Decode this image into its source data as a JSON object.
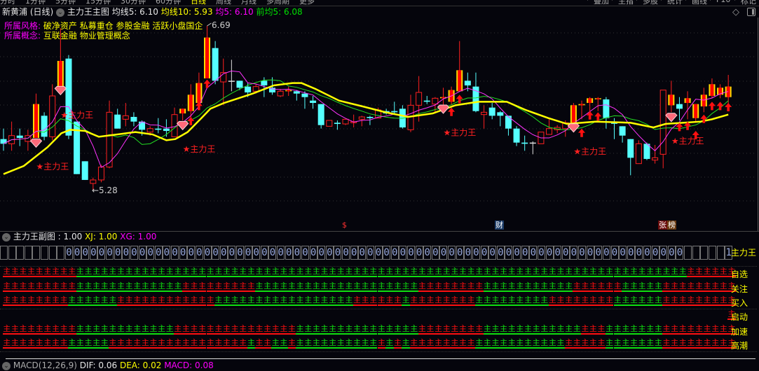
{
  "top_tabs": [
    "分时",
    "1分钟",
    "5分钟",
    "15分钟",
    "30分钟",
    "60分钟",
    "日线",
    "周线",
    "月线",
    "多周期",
    "更多"
  ],
  "top_active_tab": 6,
  "top_buttons": [
    "叠加",
    "主指",
    "多股",
    "统计",
    "画线",
    "F10",
    "标记"
  ],
  "header": {
    "stock": "新黄浦 (日线)",
    "indicator": "主力王主图",
    "ma5": "均线5: 6.10",
    "ma10": "均线10: 5.93",
    "avg5": "均5: 6.10",
    "prev_avg5": "前均5: 6.08"
  },
  "tags": {
    "style_label": "所属风格:",
    "style_value": "破净资产 私募重仓 参股金融 活跃小盘国企",
    "concept_label": "所属概念:",
    "concept_value": "互联金融 物业管理概念"
  },
  "price_labels": {
    "high": "6.69",
    "low": "←5.28",
    "high_value": 6.69,
    "low_value": 5.28
  },
  "colors": {
    "up": "#ff2020",
    "down": "#55ffff",
    "ma5": "#ff33ff",
    "ma10": "#22dd22",
    "long_ma": "#ffff00",
    "bg": "#05050c"
  },
  "chart_data": {
    "type": "candlestick",
    "price_range": [
      5.28,
      6.69
    ],
    "candles": [
      [
        5.72,
        5.68,
        5.81,
        5.62,
        "c"
      ],
      [
        5.68,
        5.75,
        5.87,
        5.62,
        "h"
      ],
      [
        5.75,
        5.73,
        5.81,
        5.66,
        "c"
      ],
      [
        5.7,
        5.75,
        5.8,
        5.62,
        "h"
      ],
      [
        5.73,
        6.02,
        6.11,
        5.73,
        "f"
      ],
      [
        5.92,
        5.74,
        5.95,
        5.71,
        "c"
      ],
      [
        5.74,
        6.09,
        6.19,
        5.71,
        "h"
      ],
      [
        6.17,
        6.39,
        6.67,
        6.17,
        "f"
      ],
      [
        6.41,
        5.75,
        6.44,
        5.72,
        "c"
      ],
      [
        5.87,
        5.42,
        5.87,
        5.42,
        "c"
      ],
      [
        5.53,
        5.37,
        5.53,
        5.37,
        "c"
      ],
      [
        5.34,
        5.37,
        5.39,
        5.28,
        "h"
      ],
      [
        5.37,
        5.48,
        5.5,
        5.35,
        "h"
      ],
      [
        5.48,
        5.95,
        6.05,
        5.47,
        "h"
      ],
      [
        5.93,
        5.81,
        5.98,
        5.81,
        "c"
      ],
      [
        5.89,
        5.92,
        6.03,
        5.83,
        "h"
      ],
      [
        5.91,
        5.87,
        5.95,
        5.83,
        "c"
      ],
      [
        5.87,
        5.8,
        5.88,
        5.75,
        "c"
      ],
      [
        5.78,
        5.81,
        5.83,
        5.75,
        "h"
      ],
      [
        5.81,
        5.8,
        5.9,
        5.77,
        "c"
      ],
      [
        5.81,
        5.79,
        5.89,
        5.74,
        "c"
      ],
      [
        5.74,
        5.93,
        5.99,
        5.74,
        "h"
      ],
      [
        5.94,
        5.98,
        5.98,
        5.88,
        "f"
      ],
      [
        5.96,
        6.1,
        6.19,
        5.88,
        "f"
      ],
      [
        6.03,
        6.2,
        6.29,
        6.03,
        "f"
      ],
      [
        6.24,
        6.59,
        6.69,
        6.24,
        "f"
      ],
      [
        6.5,
        6.22,
        6.56,
        6.19,
        "c"
      ],
      [
        6.21,
        6.29,
        6.41,
        6.01,
        "h"
      ],
      [
        6.22,
        6.22,
        6.4,
        6.13,
        "w"
      ],
      [
        6.22,
        6.16,
        6.22,
        6.14,
        "c"
      ],
      [
        6.17,
        6.12,
        6.2,
        6.08,
        "c"
      ],
      [
        6.13,
        6.17,
        6.19,
        6.11,
        "h"
      ],
      [
        6.22,
        6.18,
        6.25,
        6.08,
        "c"
      ],
      [
        6.16,
        6.12,
        6.25,
        6.1,
        "c"
      ],
      [
        6.09,
        6.13,
        6.15,
        6.08,
        "h"
      ],
      [
        6.13,
        6.14,
        6.17,
        6.09,
        "f"
      ],
      [
        6.13,
        6.11,
        6.14,
        6.05,
        "c"
      ],
      [
        6.11,
        6.08,
        6.13,
        5.98,
        "c"
      ],
      [
        6.05,
        6.03,
        6.09,
        5.98,
        "c"
      ],
      [
        6.02,
        5.84,
        6.02,
        5.81,
        "c"
      ],
      [
        5.83,
        5.88,
        5.88,
        5.83,
        "h"
      ],
      [
        5.86,
        5.85,
        5.88,
        5.8,
        "c"
      ],
      [
        5.85,
        5.89,
        5.89,
        5.84,
        "h"
      ],
      [
        5.86,
        5.87,
        5.93,
        5.82,
        "h"
      ],
      [
        5.89,
        5.91,
        5.92,
        5.83,
        "h"
      ],
      [
        5.91,
        5.9,
        5.92,
        5.84,
        "c"
      ],
      [
        5.9,
        5.97,
        5.99,
        5.9,
        "h"
      ],
      [
        5.96,
        5.94,
        5.98,
        5.93,
        "c"
      ],
      [
        5.96,
        5.95,
        6.04,
        5.93,
        "c"
      ],
      [
        5.98,
        5.82,
        6.01,
        5.81,
        "c"
      ],
      [
        5.8,
        6.01,
        6.1,
        5.78,
        "h"
      ],
      [
        6.01,
        6.12,
        6.26,
        5.87,
        "h"
      ],
      [
        6.05,
        6.04,
        6.09,
        6.02,
        "c"
      ],
      [
        6.02,
        6.07,
        6.08,
        5.95,
        "h"
      ],
      [
        6.07,
        6.08,
        6.16,
        6.01,
        "f"
      ],
      [
        6.04,
        6.14,
        6.17,
        6.01,
        "f"
      ],
      [
        6.13,
        6.31,
        6.56,
        6.13,
        "f"
      ],
      [
        6.22,
        6.18,
        6.29,
        6.13,
        "c"
      ],
      [
        6.17,
        5.96,
        6.29,
        5.95,
        "c"
      ],
      [
        5.93,
        5.95,
        6.01,
        5.81,
        "h"
      ],
      [
        5.99,
        5.92,
        6.03,
        5.89,
        "c"
      ],
      [
        5.95,
        5.92,
        5.96,
        5.83,
        "c"
      ],
      [
        5.92,
        5.81,
        5.92,
        5.75,
        "c"
      ],
      [
        5.81,
        5.69,
        5.83,
        5.66,
        "c"
      ],
      [
        5.69,
        5.68,
        5.75,
        5.62,
        "c"
      ],
      [
        5.69,
        5.69,
        5.7,
        5.59,
        "w"
      ],
      [
        5.68,
        5.78,
        5.78,
        5.68,
        "h"
      ],
      [
        5.76,
        5.81,
        5.89,
        5.76,
        "h"
      ],
      [
        5.8,
        5.82,
        5.84,
        5.77,
        "h"
      ],
      [
        5.81,
        5.86,
        5.88,
        5.74,
        "h"
      ],
      [
        5.86,
        6.01,
        6.03,
        5.86,
        "f"
      ],
      [
        6.01,
        6.02,
        6.05,
        5.89,
        "f"
      ],
      [
        6.03,
        6.07,
        6.08,
        5.9,
        "f"
      ],
      [
        6.07,
        6.07,
        6.08,
        5.96,
        "f"
      ],
      [
        6.06,
        5.9,
        6.08,
        5.81,
        "c"
      ],
      [
        5.86,
        5.86,
        5.9,
        5.72,
        "c"
      ],
      [
        5.83,
        5.75,
        5.83,
        5.69,
        "c"
      ],
      [
        5.72,
        5.56,
        5.72,
        5.41,
        "c"
      ],
      [
        5.51,
        5.68,
        5.71,
        5.51,
        "h"
      ],
      [
        5.68,
        5.55,
        5.69,
        5.54,
        "c"
      ],
      [
        5.54,
        5.56,
        5.67,
        5.51,
        "h"
      ],
      [
        5.59,
        6.14,
        6.14,
        5.47,
        "h"
      ],
      [
        6.01,
        6.1,
        6.22,
        5.95,
        "f"
      ],
      [
        6.02,
        5.98,
        6.08,
        5.88,
        "c"
      ],
      [
        6.03,
        6.07,
        6.13,
        5.89,
        "f"
      ],
      [
        5.9,
        6.02,
        6.02,
        5.86,
        "f"
      ],
      [
        6.0,
        6.1,
        6.16,
        5.95,
        "f"
      ],
      [
        6.09,
        6.19,
        6.24,
        6.07,
        "f"
      ],
      [
        6.1,
        6.16,
        6.19,
        6.07,
        "f"
      ],
      [
        6.08,
        6.17,
        6.27,
        6.01,
        "f"
      ]
    ],
    "long_ma_line": [
      [
        0,
        5.42
      ],
      [
        2.5,
        5.49
      ],
      [
        5.4,
        5.65
      ],
      [
        7.1,
        5.77
      ],
      [
        8.2,
        5.8
      ],
      [
        10,
        5.79
      ],
      [
        11.7,
        5.74
      ],
      [
        14,
        5.76
      ],
      [
        16.2,
        5.78
      ],
      [
        18.3,
        5.76
      ],
      [
        20,
        5.71
      ],
      [
        21.1,
        5.72
      ],
      [
        22.6,
        5.78
      ],
      [
        24.3,
        5.9
      ],
      [
        25.4,
        5.98
      ],
      [
        27.1,
        6.03
      ],
      [
        30.6,
        6.11
      ],
      [
        33.2,
        6.18
      ],
      [
        35.5,
        6.2
      ],
      [
        36.6,
        6.2
      ],
      [
        38.3,
        6.15
      ],
      [
        41.2,
        6.05
      ],
      [
        44.1,
        6.0
      ],
      [
        46.9,
        5.95
      ],
      [
        49.7,
        5.91
      ],
      [
        52.7,
        5.94
      ],
      [
        55.5,
        6.01
      ],
      [
        58.3,
        6.04
      ],
      [
        60.7,
        6.04
      ],
      [
        61.8,
        6.04
      ],
      [
        64.1,
        5.97
      ],
      [
        66.9,
        5.9
      ],
      [
        69.2,
        5.85
      ],
      [
        72.7,
        5.87
      ],
      [
        77,
        5.86
      ],
      [
        79.8,
        5.82
      ],
      [
        81.3,
        5.85
      ],
      [
        85.6,
        5.87
      ],
      [
        87,
        5.89
      ],
      [
        89,
        5.93
      ]
    ],
    "diamonds": [
      [
        4,
        5.68
      ],
      [
        7,
        6.13
      ],
      [
        22,
        5.83
      ],
      [
        54,
        5.97
      ],
      [
        70,
        5.81
      ],
      [
        82,
        5.9
      ]
    ],
    "arrows": [
      [
        23,
        5.91
      ],
      [
        24,
        6.04
      ],
      [
        25,
        6.23
      ],
      [
        55,
        5.99
      ],
      [
        56,
        6.1
      ],
      [
        71,
        5.81
      ],
      [
        72,
        5.96
      ],
      [
        73,
        5.95
      ],
      [
        83,
        5.86
      ],
      [
        84,
        5.87
      ],
      [
        85,
        5.79
      ],
      [
        86,
        5.93
      ],
      [
        87,
        6.04
      ],
      [
        88,
        6.04
      ],
      [
        89,
        6.03
      ]
    ],
    "signal_label": "★主力王",
    "signals": [
      [
        4,
        5.49
      ],
      [
        7,
        5.93
      ],
      [
        22,
        5.64
      ],
      [
        54,
        5.78
      ],
      [
        70,
        5.62
      ],
      [
        82,
        5.71
      ]
    ]
  },
  "bottom_markers": [
    {
      "text": "$",
      "kind": "dollar"
    },
    {
      "text": "财",
      "kind": "finance"
    },
    {
      "text": "张",
      "kind": "limit"
    },
    {
      "text": "榜",
      "kind": "board"
    }
  ],
  "sub": {
    "title": "主力王副图",
    "value": ": 1.00",
    "xj": "XJ: 1.00",
    "xg": "XG: 1.00",
    "box_label": "主力王",
    "box_runs": [
      [
        "",
        8
      ],
      [
        "0",
        76
      ],
      [
        "",
        5
      ],
      [
        "1",
        1
      ]
    ],
    "glyph": "主",
    "rows": [
      {
        "label": "自选",
        "runs": [
          [
            "R",
            9
          ],
          [
            "G",
            75
          ],
          [
            "R",
            6
          ]
        ]
      },
      {
        "label": "关注",
        "runs": [
          [
            "R",
            9
          ],
          [
            "G",
            13
          ],
          [
            "R",
            9
          ],
          [
            "G",
            20
          ],
          [
            "R",
            8
          ],
          [
            "G",
            11
          ],
          [
            "R",
            6
          ],
          [
            "G",
            5
          ],
          [
            "R",
            9
          ]
        ]
      },
      {
        "label": "买入",
        "runs": [
          [
            "R",
            8
          ],
          [
            "G",
            6
          ],
          [
            "R",
            12
          ],
          [
            "G",
            17
          ],
          [
            "R",
            6
          ],
          [
            "G",
            1
          ],
          [
            "R",
            8
          ],
          [
            "G",
            9
          ],
          [
            "R",
            8
          ],
          [
            "G",
            6
          ],
          [
            "R",
            9
          ]
        ]
      },
      {
        "label": "启动",
        "runs": [
          [
            "-",
            89
          ],
          [
            "R",
            1
          ]
        ]
      },
      {
        "label": "加速",
        "runs": [
          [
            "R",
            9
          ],
          [
            "G",
            12
          ],
          [
            "R",
            15
          ],
          [
            "G",
            15
          ],
          [
            "R",
            8
          ],
          [
            "G",
            12
          ],
          [
            "R",
            3
          ],
          [
            "G",
            7
          ],
          [
            "R",
            9
          ]
        ]
      },
      {
        "label": "高潮",
        "runs": [
          [
            "R",
            8
          ],
          [
            "G",
            5
          ],
          [
            "R",
            17
          ],
          [
            "G",
            1
          ],
          [
            "R",
            2
          ],
          [
            "G",
            2
          ],
          [
            "R",
            1
          ],
          [
            "G",
            10
          ],
          [
            "R",
            1
          ],
          [
            "G",
            1
          ],
          [
            "R",
            1
          ],
          [
            "G",
            1
          ],
          [
            "R",
            8
          ],
          [
            "G",
            11
          ],
          [
            "R",
            5
          ],
          [
            "G",
            7
          ],
          [
            "R",
            9
          ]
        ]
      }
    ]
  },
  "macd": {
    "title": "MACD(12,26,9)",
    "dif": "DIF: 0.06",
    "dea": "DEA: 0.02",
    "macd": "MACD: 0.08"
  }
}
